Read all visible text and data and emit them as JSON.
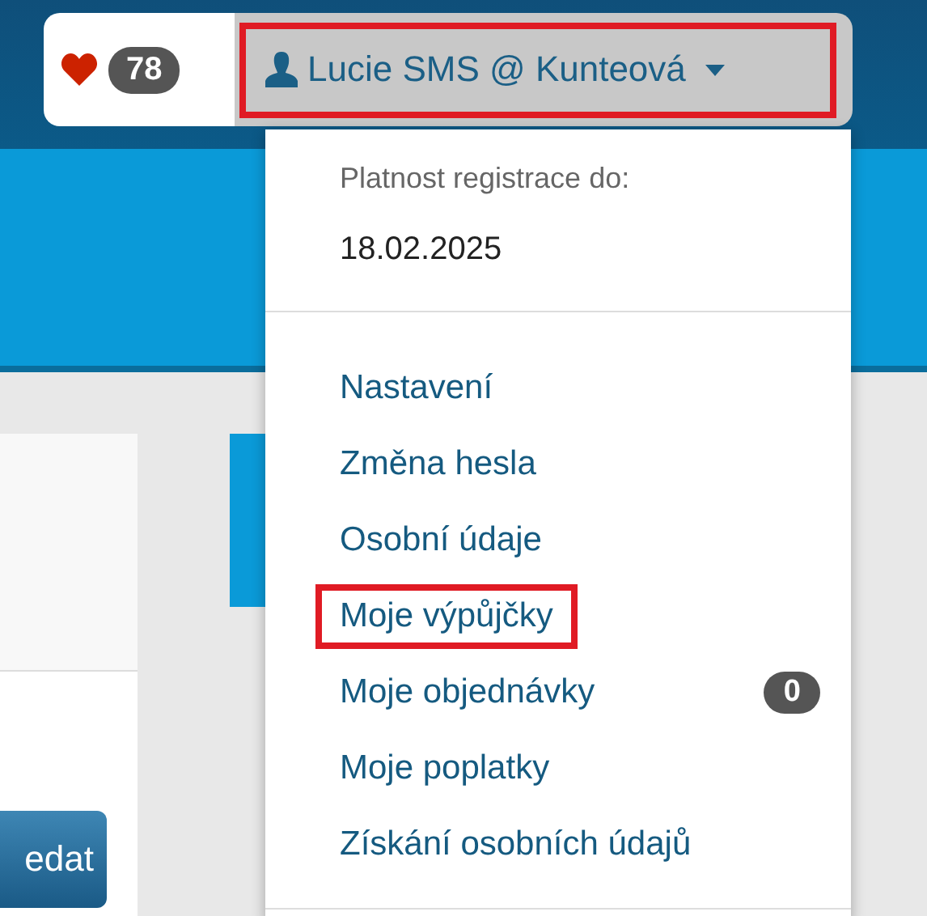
{
  "favorites": {
    "count": "78"
  },
  "user_menu": {
    "label": "Lucie SMS @ Kunteová",
    "highlighted": true,
    "expanded": true
  },
  "dropdown": {
    "registration_label": "Platnost registrace do:",
    "registration_date": "18.02.2025",
    "items": [
      {
        "label": "Nastavení",
        "highlighted": false
      },
      {
        "label": "Změna hesla",
        "highlighted": false
      },
      {
        "label": "Osobní údaje",
        "highlighted": false
      },
      {
        "label": "Moje výpůjčky",
        "highlighted": true
      },
      {
        "label": "Moje objednávky",
        "highlighted": false,
        "badge": "0"
      },
      {
        "label": "Moje poplatky",
        "highlighted": false
      },
      {
        "label": "Získání osobních údajů",
        "highlighted": false
      }
    ]
  },
  "page": {
    "button": "edat"
  }
}
